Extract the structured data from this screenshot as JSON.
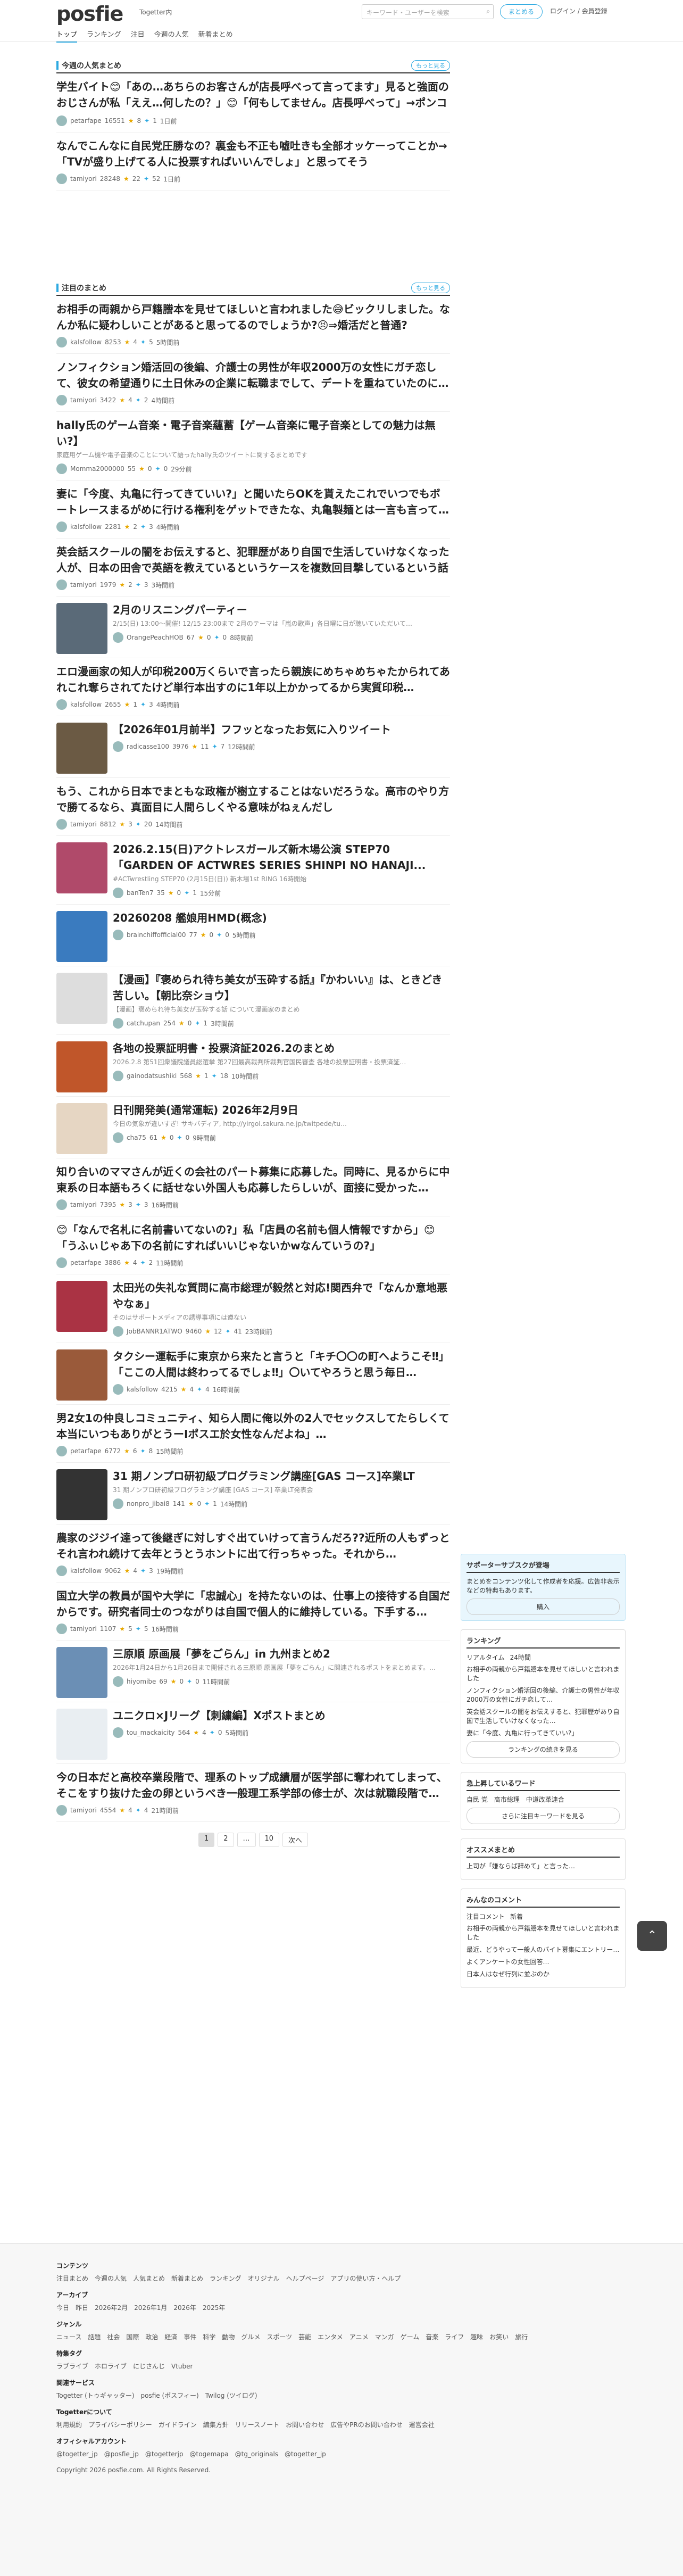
{
  "header": {
    "logo_main": "posfie",
    "byline": "Togetter内",
    "nav": [
      "トップ",
      "ランキング",
      "注目",
      "今週の人気",
      "新着まとめ"
    ],
    "search_placeholder": "キーワード・ユーザーを検索",
    "make_button": "まとめる",
    "login": "ログイン / 会員登録"
  },
  "sections": [
    {
      "title": "今週の人気まとめ",
      "more": "もっと見る",
      "items": [
        {
          "title": "学生バイト😊「あの…あちらのお客さんが店長呼べって言ってます」見ると強面のおじさんが私「ええ…何したの？」😊「何もしてません。店長呼べって」→ポンコツ…",
          "user": "petarfape",
          "pv": "16551",
          "stars": "8",
          "rts": "1",
          "when": "1日前"
        },
        {
          "title": "なんでこんなに自民党圧勝なの？裏金も不正も嘘吐きも全部オッケーってことか→「TVが盛り上げてる人に投票すればいいんでしょ」と思ってそう",
          "user": "tamiyori",
          "pv": "28248",
          "stars": "22",
          "rts": "52",
          "when": "1日前"
        }
      ]
    },
    {
      "title": "注目のまとめ",
      "more": "もっと見る",
      "items": [
        {
          "title": "お相手の両親から戸籍謄本を見せてほしいと言われました😅ビックリしました。なんか私に疑わしいことがあると思ってるのでしょうか?😣⇒婚活だと普通?",
          "user": "kalsfollow",
          "pv": "8253",
          "stars": "4",
          "rts": "5",
          "when": "5時間前"
        },
        {
          "title": "ノンフィクション婚活回の後編、介護士の男性が年収2000万の女性にガチ恋して、彼女の希望通りに土日休みの企業に転職までして、デートを重ねていたのに…",
          "user": "tamiyori",
          "pv": "3422",
          "stars": "4",
          "rts": "2",
          "when": "4時間前"
        },
        {
          "title": "hally氏のゲーム音楽・電子音楽蘊蓄【ゲーム音楽に電子音楽としての魅力は無い?】",
          "desc": "家庭用ゲーム機や電子音楽のことについて語ったhally氏のツイートに関するまとめです",
          "user": "Momma2000000",
          "pv": "55",
          "stars": "0",
          "rts": "0",
          "when": "29分前"
        },
        {
          "title": "妻に「今度、丸亀に行ってきていい?」と聞いたらOKを貰えたこれでいつでもボートレースまるがめに行ける権利をゲットできたな、丸亀製麺とは一言も言って…",
          "user": "kalsfollow",
          "pv": "2281",
          "stars": "2",
          "rts": "3",
          "when": "4時間前"
        },
        {
          "title": "英会話スクールの闇をお伝えすると、犯罪歴があり自国で生活していけなくなった人が、日本の田舎で英語を教えているというケースを複数回目撃しているという話",
          "user": "tamiyori",
          "pv": "1979",
          "stars": "2",
          "rts": "3",
          "when": "3時間前"
        },
        {
          "title": "2月のリスニングパーティー",
          "desc": "2/15(日) 13:00〜開催! 12/15 23:00まで 2月のテーマは「嵐の歌声」各日曜に日が聴いていただいて…",
          "user": "OrangePeachHOB",
          "pv": "67",
          "stars": "0",
          "rts": "0",
          "when": "8時間前",
          "thumb": "#5a6a78"
        },
        {
          "title": "エロ漫画家の知人が印税200万くらいで言ったら親族にめちゃめちゃたかられてあれこれ奪らされてたけど単行本出すのに1年以上かかってるから実質印税…",
          "user": "kalsfollow",
          "pv": "2655",
          "stars": "1",
          "rts": "3",
          "when": "4時間前"
        },
        {
          "title": "【2026年01月前半】フフッとなったお気に入りツイート",
          "user": "radicasse100",
          "pv": "3976",
          "stars": "11",
          "rts": "7",
          "when": "12時間前",
          "thumb": "#6b5a44"
        },
        {
          "title": "もう、これから日本でまともな政権が樹立することはないだろうな。高市のやり方で勝てるなら、真面目に人間らしくやる意味がねぇんだし",
          "user": "tamiyori",
          "pv": "8812",
          "stars": "3",
          "rts": "20",
          "when": "14時間前"
        },
        {
          "title": "2026.2.15(日)アクトレスガールズ新木場公演 STEP70「GARDEN OF ACTWRES SERIES SHINPI NO HANAJI...",
          "desc": "#ACTwrestling STEP70 (2月15日(日)) 新木場1st RING 16時開始",
          "user": "banTen7",
          "pv": "35",
          "stars": "0",
          "rts": "1",
          "when": "15分前",
          "thumb": "#b04a6a"
        },
        {
          "title": "20260208 艦娘用HMD(概念)",
          "user": "brainchiffofficial00",
          "pv": "77",
          "stars": "0",
          "rts": "0",
          "when": "5時間前",
          "thumb": "#3a7bbf"
        },
        {
          "title": "【漫画】『褒められ待ち美女が玉砕する話』『かわいい』は、ときどき苦しい。【朝比奈ショウ】",
          "desc": "【漫画】褒められ待ち美女が玉砕する話 について漫画家のまとめ",
          "user": "catchupan",
          "pv": "254",
          "stars": "0",
          "rts": "1",
          "when": "3時間前",
          "thumb": "#ddd"
        },
        {
          "title": "各地の投票証明書・投票済証2026.2のまとめ",
          "desc": "2026.2.8 第51回衆議院議員総選挙 第27回最高裁判所裁判官国民審査 各地の投票証明書・投票済証…",
          "user": "gainodatsushiki",
          "pv": "568",
          "stars": "1",
          "rts": "18",
          "when": "10時間前",
          "thumb": "#c0562a"
        },
        {
          "title": "日刊開発美(通常運転) 2026年2月9日",
          "desc": "今日の気象が違いすぎ! サキバディア, http://yirgol.sakura.ne.jp/twitpede/tu…",
          "user": "cha75",
          "pv": "61",
          "stars": "0",
          "rts": "0",
          "when": "9時間前",
          "thumb": "#e6d6c3"
        },
        {
          "title": "知り合いのママさんが近くの会社のパート募集に応募した。同時に、見るからに中東系の日本語もろくに話せない外国人も応募したらしいが、面接に受かった…",
          "user": "tamiyori",
          "pv": "7395",
          "stars": "3",
          "rts": "3",
          "when": "16時間前"
        },
        {
          "title": "😊「なんで名札に名前書いてないの?」私「店員の名前も個人情報ですから」😊「うふぃじゃあ下の名前にすればいいじゃないかwなんていうの?」",
          "user": "petarfape",
          "pv": "3886",
          "stars": "4",
          "rts": "2",
          "when": "11時間前"
        },
        {
          "title": "太田光の失礼な質問に高市総理が毅然と対応!関西弁で「なんか意地悪やなぁ」",
          "desc": "そのはサポートメディアの誘導事項には遵ない",
          "user": "JobBANNR1ATWO",
          "pv": "9460",
          "stars": "12",
          "rts": "41",
          "when": "23時間前",
          "thumb": "#aa3344"
        },
        {
          "title": "タクシー運転手に東京から来たと言うと「キチ〇〇の町へようこそ‼」「ここの人間は終わってるでしょ‼」〇いてやろうと思う毎日…",
          "user": "kalsfollow",
          "pv": "4215",
          "stars": "4",
          "rts": "4",
          "when": "16時間前",
          "thumb": "#9a5a3a"
        },
        {
          "title": "男2女1の仲良しコミュニティ、知ら人間に俺以外の2人でセックスしてたらしくて本当にいつもありがとうーIポスエ於女性なんだよね」…",
          "user": "petarfape",
          "pv": "6772",
          "stars": "6",
          "rts": "8",
          "when": "15時間前"
        },
        {
          "title": "31 期ノンプロ研初級プログラミング講座[GAS コース]卒業LT",
          "desc": "31 期ノンプロ研初級プログラミング講座 [GAS コース] 卒業LT発表会",
          "user": "nonpro_jibai8",
          "pv": "141",
          "stars": "0",
          "rts": "1",
          "when": "14時間前",
          "thumb": "#333"
        },
        {
          "title": "農家のジジイ達って後継ぎに対しすぐ出ていけって言うんだろ??近所の人もずっとそれ言われ続けて去年とうとうホントに出て行っちゃった。それから…",
          "user": "kalsfollow",
          "pv": "9062",
          "stars": "4",
          "rts": "3",
          "when": "19時間前"
        },
        {
          "title": "国立大学の教員が国や大学に「忠誠心」を持たないのは、仕事上の接待する自国だからです。研究者同士のつながりは自国で個人的に維持している。下手する…",
          "user": "tamiyori",
          "pv": "1107",
          "stars": "5",
          "rts": "5",
          "when": "16時間前"
        },
        {
          "title": "三原順 原画展「夢をごらん」in 九州まとめ2",
          "desc": "2026年1月24日から1月26日まで開催される三原順 原画展「夢をごらん」に関連されるポストをまとめます。…",
          "user": "hiyomibe",
          "pv": "69",
          "stars": "0",
          "rts": "0",
          "when": "11時間前",
          "thumb": "#6b8fb5"
        },
        {
          "title": "ユニクロ×Jリーグ【刺繍編】Xポストまとめ",
          "user": "tou_mackaicity",
          "pv": "564",
          "stars": "4",
          "rts": "0",
          "when": "5時間前",
          "thumb": "#e9eef2"
        },
        {
          "title": "今の日本だと高校卒業段階で、理系のトップ成績層が医学部に奪われてしまって、そこをすり抜けた金の卵というべき一般理工系学部の修士が、次は就職段階で…",
          "user": "tamiyori",
          "pv": "4554",
          "stars": "4",
          "rts": "4",
          "when": "21時間前"
        }
      ]
    }
  ],
  "pager": [
    "1",
    "2",
    "…",
    "10",
    "次へ"
  ],
  "side": {
    "supporter_title": "サポーターサブスクが登場",
    "supporter_btn": "購入",
    "supporter_text": "まとめをコンテンツ化して作成者を応援。広告非表示などの特典もあります。",
    "ranking_title": "ランキング",
    "ranking_tabs": [
      "リアルタイム",
      "24時間"
    ],
    "ranking_items": [
      "お相手の両親から戸籍謄本を見せてほしいと言われました",
      "ノンフィクション婚活回の後編、介護士の男性が年収2000万の女性にガチ恋して…",
      "英会話スクールの闇をお伝えすると、犯罪歴があり自国で生活していけなくなった…",
      "妻に「今度、丸亀に行ってきていい?」"
    ],
    "ranking_btn": "ランキングの続きを見る",
    "keyword_title": "急上昇しているワード",
    "keywords": [
      "自民 党",
      "高市総理",
      "中道改革連合"
    ],
    "keyword_btn": "さらに注目キーワードを見る",
    "pick_title": "オススメまとめ",
    "pick_text": "上司が「嫌ならば辞めて」と言った…",
    "comment_title": "みんなのコメント",
    "comment_tabs": [
      "注目コメント",
      "新着"
    ],
    "comments": [
      "お相手の両親から戸籍謄本を見せてほしいと言われました",
      "最近、どうやって一般人のバイト募集にエントリー…",
      "よくアンケートの女性回答…",
      "日本人はなぜ行列に並ぶのか"
    ]
  },
  "footer": {
    "content_title": "コンテンツ",
    "content": "注目まとめ　今週の人気　人気まとめ　新着まとめ　ランキング　オリジナル　ヘルプページ　アプリの使い方・ヘルプ",
    "archive_title": "アーカイブ",
    "archive": "今日　昨日　2026年2月　2026年1月　2026年　2025年",
    "genre_title": "ジャンル",
    "genre": "ニュース　話題　社会　国際　政治　経済　事件　科学　動物　グルメ　スポーツ　芸能　エンタメ　アニメ　マンガ　ゲーム　音楽　ライフ　趣味　お笑い　旅行",
    "tag_title": "特集タグ",
    "tag": "ラブライブ　ホロライブ　にじさんじ　Vtuber",
    "related_title": "関連サービス",
    "related": "Togetter (トゥギャッター)　posfie (ポスフィー)　Twilog (ツイログ)",
    "tog_title": "Togetterについて",
    "tog": "利用規約　プライバシーポリシー　ガイドライン　編集方針　リリースノート　お問い合わせ　広告やPRのお問い合わせ　運営会社",
    "official_title": "オフィシャルアカウント",
    "official": "@togetter_jp　@posfie_jp　@togetterjp　@togemapa　@tg_originals　@togetter_jp",
    "copyright": "Copyright 2026 posfie.com. All Rights Reserved."
  }
}
